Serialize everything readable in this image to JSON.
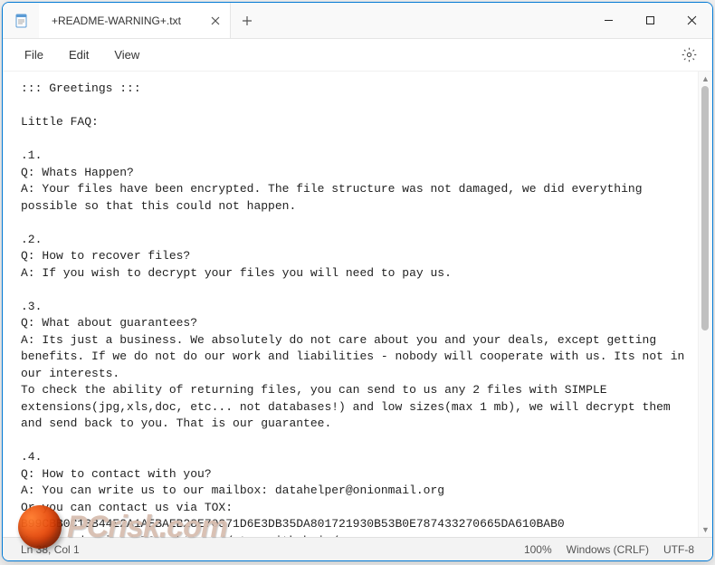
{
  "tab": {
    "title": "+README-WARNING+.txt"
  },
  "menu": {
    "file": "File",
    "edit": "Edit",
    "view": "View"
  },
  "content": "::: Greetings :::\n\nLittle FAQ:\n\n.1.\nQ: Whats Happen?\nA: Your files have been encrypted. The file structure was not damaged, we did everything possible so that this could not happen.\n\n.2.\nQ: How to recover files?\nA: If you wish to decrypt your files you will need to pay us.\n\n.3.\nQ: What about guarantees?\nA: Its just a business. We absolutely do not care about you and your deals, except getting benefits. If we do not do our work and liabilities - nobody will cooperate with us. Its not in our interests.\nTo check the ability of returning files, you can send to us any 2 files with SIMPLE extensions(jpg,xls,doc, etc... not databases!) and low sizes(max 1 mb), we will decrypt them and send back to you. That is our guarantee.\n\n.4.\nQ: How to contact with you?\nA: You can write us to our mailbox: datahelper@onionmail.org\nOr you can contact us via TOX: B99CBB0C13B44E2A1AEBAEB28E70371D6E3DB35DA801721930B53B0E787433270665DA610BAB0\nYou can download TOX: https://qtox.github.io/",
  "status": {
    "position": "Ln 38, Col 1",
    "zoom": "100%",
    "eol": "Windows (CRLF)",
    "encoding": "UTF-8"
  },
  "watermark": "PCrisk.com"
}
